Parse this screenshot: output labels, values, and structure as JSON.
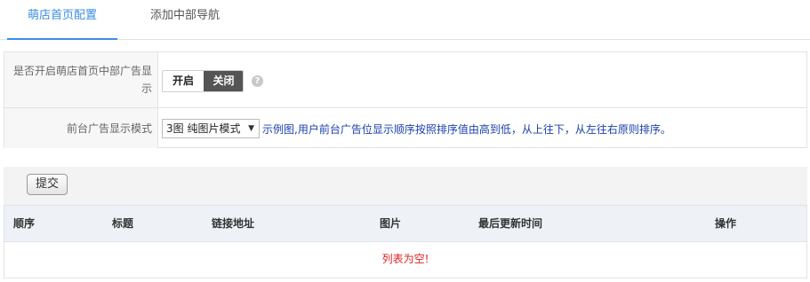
{
  "tabs": [
    {
      "label": "萌店首页配置",
      "active": true
    },
    {
      "label": "添加中部导航",
      "active": false
    }
  ],
  "form": {
    "ad_toggle": {
      "label": "是否开启萌店首页中部广告显示",
      "on_label": "开启",
      "off_label": "关闭",
      "selected": "关闭",
      "help_icon": "question-circle"
    },
    "display_mode": {
      "label": "前台广告显示模式",
      "selected": "3图 纯图片模式",
      "hint": "示例图,用户前台广告位显示顺序按照排序值由高到低，从上往下，从左往右原则排序。"
    }
  },
  "toolbar": {
    "submit_label": "提交"
  },
  "table": {
    "columns": [
      "顺序",
      "标题",
      "链接地址",
      "图片",
      "最后更新时间",
      "操作"
    ],
    "rows": [],
    "empty_text": "列表为空!"
  },
  "colors": {
    "accent": "#3a8ee6",
    "toggle_active_bg": "#555555",
    "hint_text": "#1a3fae",
    "empty_text": "#e02020"
  }
}
